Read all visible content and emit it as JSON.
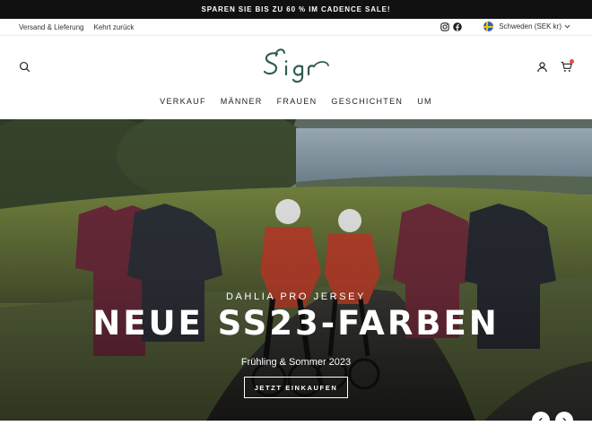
{
  "promo": {
    "text": "SPAREN SIE BIS ZU 60 % IM CADENCE SALE!"
  },
  "utility": {
    "links": [
      "Versand & Lieferung",
      "Kehrt zurück"
    ],
    "social_icons": [
      "instagram-icon",
      "facebook-icon"
    ],
    "currency_label": "Schweden (SEK kr)",
    "flag": "sweden-flag-icon"
  },
  "header": {
    "logo_text": "Sigr",
    "icons": [
      "search-icon",
      "user-icon",
      "cart-icon"
    ],
    "cart_badge_color": "#e84b3c"
  },
  "nav": {
    "items": [
      "VERKAUF",
      "MÄNNER",
      "FRAUEN",
      "GESCHICHTEN",
      "UM"
    ]
  },
  "hero": {
    "eyebrow": "DAHLIA PRO JERSEY",
    "title": "NEUE SS23-FARBEN",
    "subtitle": "Frühling & Sommer 2023",
    "cta": "JETZT EINKAUFEN",
    "prev_icon": "chevron-left-icon",
    "next_icon": "chevron-right-icon"
  },
  "colors": {
    "promo_bg": "#111111",
    "brand": "#2f5d54",
    "text": "#222222"
  }
}
